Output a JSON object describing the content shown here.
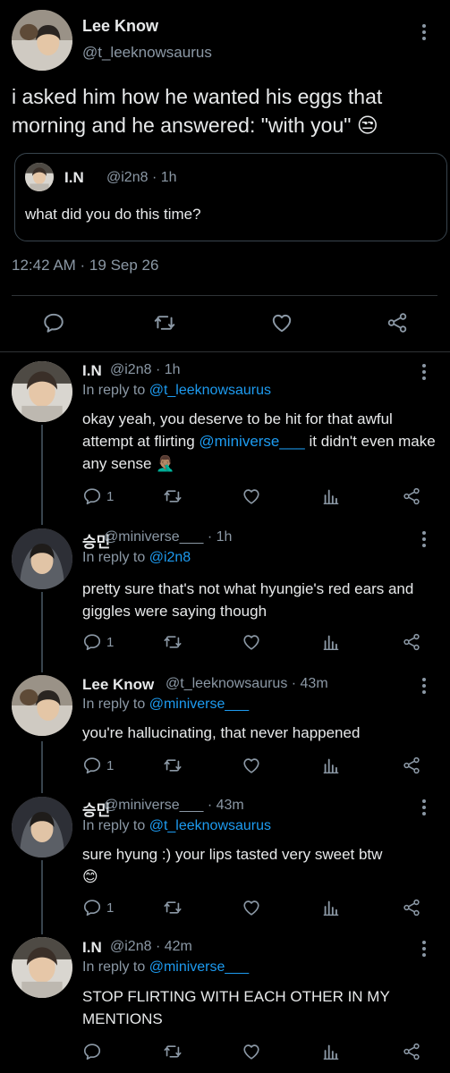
{
  "main_tweet": {
    "name": "Lee Know",
    "handle": "@t_leeknowsaurus",
    "text": "i asked him how he wanted his eggs that morning and he answered: \"with you\"",
    "emoji": "😒",
    "quote": {
      "name": "I.N",
      "meta": "@i2n8 · 1h",
      "text": "what did you do this time?"
    },
    "timestamp": "12:42 AM · 19 Sep 26"
  },
  "replies": [
    {
      "name": "I.N",
      "meta": "@i2n8 · 1h",
      "reply_prefix": "In reply to ",
      "reply_to": "@t_leeknowsaurus",
      "text_before": "okay yeah, you deserve to be hit for that awful attempt at flirting ",
      "mention": "@miniverse___",
      "text_after": " it didn't even make any sense",
      "emoji": "🤦🏽‍♂️",
      "reply_count": "1"
    },
    {
      "name": "승민",
      "meta": "@miniverse___ · 1h",
      "reply_prefix": "In reply to ",
      "reply_to": "@i2n8",
      "text": "pretty sure that's not what hyungie's red ears and giggles were saying though",
      "reply_count": "1"
    },
    {
      "name": "Lee Know",
      "meta": "@t_leeknowsaurus · 43m",
      "reply_prefix": "In reply to ",
      "reply_to": "@miniverse___",
      "text": "you're hallucinating, that never happened",
      "reply_count": "1"
    },
    {
      "name": "승민",
      "meta": "@miniverse___ · 43m",
      "reply_prefix": "In reply to ",
      "reply_to": "@t_leeknowsaurus",
      "text": "sure hyung :) your lips tasted very sweet btw",
      "emoji": "😊",
      "reply_count": "1"
    },
    {
      "name": "I.N",
      "meta": "@i2n8 · 42m",
      "reply_prefix": "In reply to ",
      "reply_to": "@miniverse___",
      "text": "STOP FLIRTING WITH EACH OTHER IN MY MENTIONS",
      "reply_count": ""
    }
  ],
  "colors": {
    "background": "#000000",
    "text": "#e7e9ea",
    "secondary": "#8b98a5",
    "link": "#1d9bf0",
    "divider": "#2f3336"
  },
  "icons": [
    "comment-icon",
    "retweet-icon",
    "like-icon",
    "share-icon",
    "analytics-icon",
    "more-icon"
  ]
}
